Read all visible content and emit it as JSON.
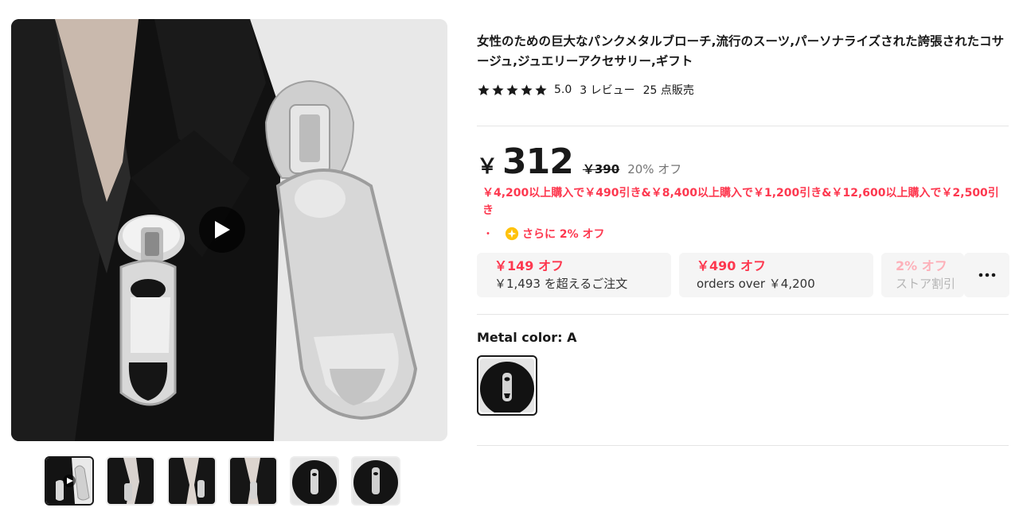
{
  "product": {
    "title": "女性のための巨大なパンクメタルブローチ,流行のスーツ,パーソナライズされた誇張されたコサージュ,ジュエリーアクセサリー,ギフト",
    "rating": "5.0",
    "reviews": "3 レビュー",
    "sold": "25 点販売",
    "stars": 5
  },
  "price": {
    "currency": "￥",
    "current": "312",
    "original": "￥390",
    "discount": "20% オフ"
  },
  "promo": {
    "text": "￥4,200以上購入で￥490引き&￥8,400以上購入で￥1,200引き&￥12,600以上購入で￥2,500引き",
    "bullet": "・",
    "extra": "さらに 2% オフ"
  },
  "coupons": [
    {
      "amount": "￥149 オフ",
      "desc": "￥1,493 を超えるご注文"
    },
    {
      "amount": "￥490 オフ",
      "desc": "orders over ￥4,200"
    },
    {
      "amount": "2% オフ",
      "desc": "ストア割引"
    }
  ],
  "more_label": "···",
  "variant": {
    "label": "Metal color: A"
  },
  "gallery": {
    "thumb_count": 6,
    "active_index": 0
  },
  "colors": {
    "accent": "#fd384f",
    "text": "#191919",
    "muted": "#757575",
    "coin": "#ffc20a"
  },
  "icons": {
    "play": "play-icon",
    "star": "star-icon",
    "coin": "coin-icon",
    "more": "more-dots-icon"
  }
}
